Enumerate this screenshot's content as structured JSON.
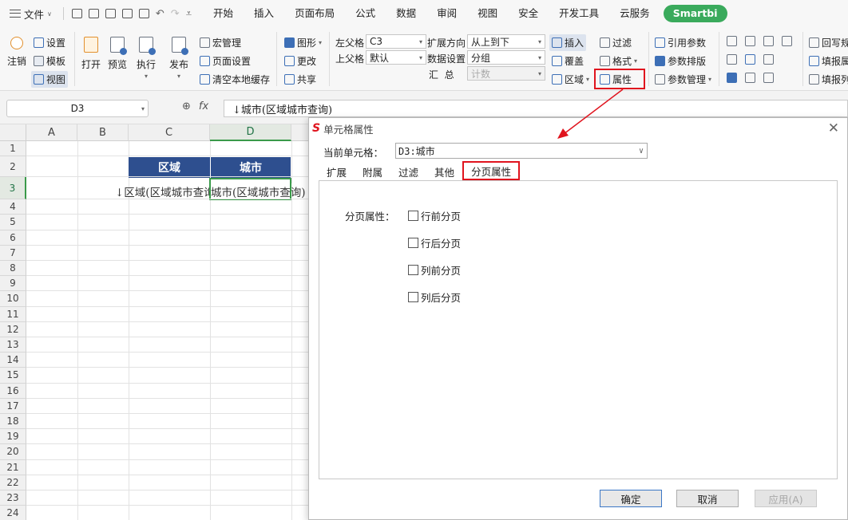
{
  "menubar": {
    "file_label": "文件",
    "menus": [
      "开始",
      "插入",
      "页面布局",
      "公式",
      "数据",
      "审阅",
      "视图",
      "安全",
      "开发工具",
      "云服务"
    ],
    "smartbi": "Smartbi"
  },
  "ribbon": {
    "logout": "注销",
    "settings": "设置",
    "template": "模板",
    "view": "视图",
    "open": "打开",
    "preview": "预览",
    "execute": "执行",
    "publish": "发布",
    "macro": "宏管理",
    "page_setup": "页面设置",
    "clear_cache": "清空本地缓存",
    "chart": "图形",
    "change": "更改",
    "share": "共享",
    "left_parent_label": "左父格",
    "left_parent_value": "C3",
    "top_parent_label": "上父格",
    "top_parent_value": "默认",
    "expand_dir_label": "扩展方向",
    "expand_dir_value": "从上到下",
    "data_setting_label": "数据设置",
    "data_setting_value": "分组",
    "summary_label": "汇  总",
    "summary_value": "计数",
    "insert": "插入",
    "cover": "覆盖",
    "region": "区域",
    "filter": "过滤",
    "format": "格式",
    "property": "属性",
    "ref_param": "引用参数",
    "param_layout": "参数排版",
    "param_mgmt": "参数管理",
    "writeback": "回写规",
    "report_attr": "填报属",
    "report_col": "填报列"
  },
  "formula": {
    "cell_ref": "D3",
    "fx": "fx",
    "content": "↓城市(区域城市查询)"
  },
  "grid": {
    "columns": [
      "A",
      "B",
      "C",
      "D"
    ],
    "rows": [
      "1",
      "2",
      "3",
      "4",
      "5",
      "6",
      "7",
      "8",
      "9",
      "10",
      "11",
      "12",
      "13",
      "14",
      "15",
      "16",
      "17",
      "18",
      "19",
      "20",
      "21",
      "22",
      "23",
      "24"
    ],
    "header_c2": "区域",
    "header_d2": "城市",
    "cell_c3": "↓区域(区域城市查询)",
    "cell_d3": "城市(区域城市查询)"
  },
  "dialog": {
    "title": "单元格属性",
    "current_cell_label": "当前单元格：",
    "current_cell_value": "D3:城市",
    "tabs": [
      "扩展",
      "附属",
      "过滤",
      "其他",
      "分页属性"
    ],
    "page_break_label": "分页属性：",
    "options": [
      "行前分页",
      "行后分页",
      "列前分页",
      "列后分页"
    ],
    "ok": "确定",
    "cancel": "取消",
    "apply": "应用(A)"
  },
  "colors": {
    "header_fill": "#2e4f8f",
    "select_green": "#3a9a4a",
    "highlight_red": "#e0141e",
    "smartbi_green": "#3aaa5c"
  }
}
